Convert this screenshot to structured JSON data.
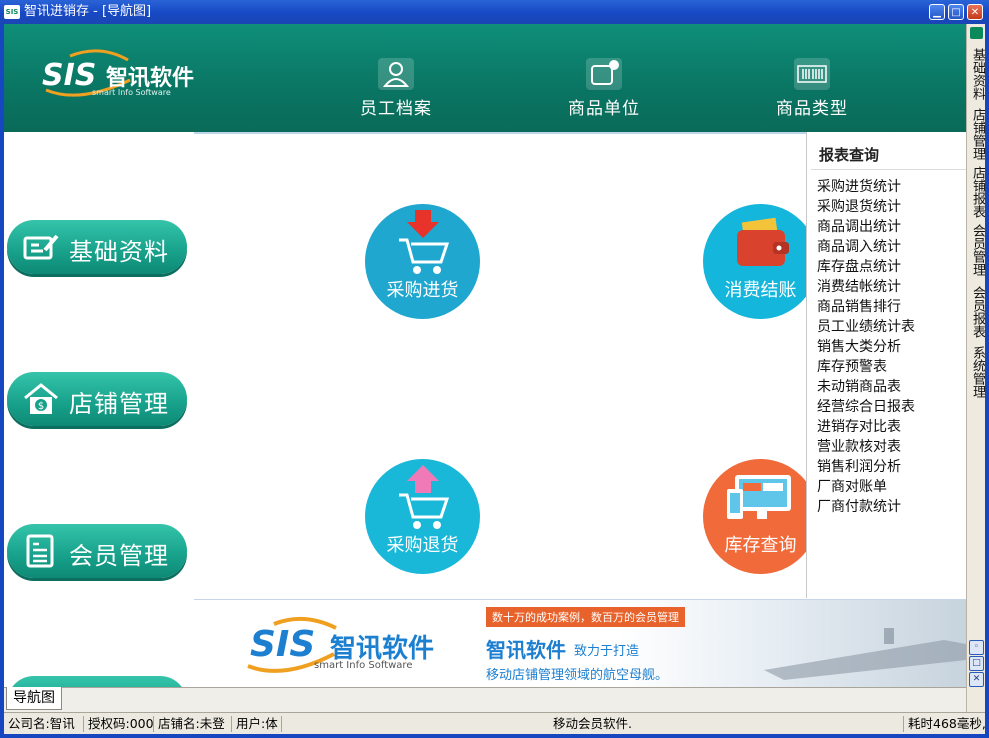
{
  "window": {
    "title": "智讯进销存 - [导航图]",
    "app_icon": "SIS"
  },
  "header": {
    "logo": {
      "brand": "SIS",
      "name": "智讯软件",
      "sub": "smart Info Software"
    },
    "nav": [
      {
        "label": "员工档案",
        "icon": "user-icon"
      },
      {
        "label": "商品单位",
        "icon": "unit-icon"
      },
      {
        "label": "商品类型",
        "icon": "barcode-icon"
      }
    ]
  },
  "sidebar": {
    "items": [
      {
        "label": "基础资料",
        "icon": "edit-card-icon"
      },
      {
        "label": "店铺管理",
        "icon": "store-icon"
      },
      {
        "label": "会员管理",
        "icon": "document-icon"
      }
    ]
  },
  "main": {
    "buttons": [
      {
        "label": "采购进货",
        "icon": "cart-in-icon",
        "color": "#1fa7cf"
      },
      {
        "label": "消费结账",
        "icon": "wallet-icon",
        "color": "#15b6db"
      },
      {
        "label": "采购退货",
        "icon": "cart-out-icon",
        "color": "#19b8d8"
      },
      {
        "label": "库存查询",
        "icon": "monitor-icon",
        "color": "#f06a3a"
      }
    ]
  },
  "reports": {
    "title": "报表查询",
    "items": [
      "采购进货统计",
      "采购退货统计",
      "商品调出统计",
      "商品调入统计",
      "库存盘点统计",
      "消费结帐统计",
      "商品销售排行",
      "员工业绩统计表",
      "销售大类分析",
      "库存预警表",
      "未动销商品表",
      "经营综合日报表",
      "进销存对比表",
      "营业款核对表",
      "销售利润分析",
      "厂商对账单",
      "厂商付款统计"
    ]
  },
  "right_tabs": [
    "基础资料",
    "店铺管理",
    "店铺报表",
    "会员管理",
    "会员报表",
    "系统管理"
  ],
  "banner": {
    "brand": "SIS",
    "name": "智讯软件",
    "sub": "smart Info Software",
    "tag": "数十万的成功案例，数百万的会员管理",
    "slogan_main": "智讯软件",
    "slogan_side": "致力于打造",
    "slogan_line2": "移动店铺管理领域的航空母舰。"
  },
  "bottom_tab": "导航图",
  "status": {
    "company": "公司名:智讯",
    "license": "授权码:000",
    "store": "店铺名:未登",
    "user": "用户:体",
    "center": "移动会员软件.",
    "elapsed": "耗时468毫秒,"
  },
  "colors": {
    "header": "#0a7563",
    "accent": "#17a08a",
    "titlebar": "#1748c4"
  }
}
